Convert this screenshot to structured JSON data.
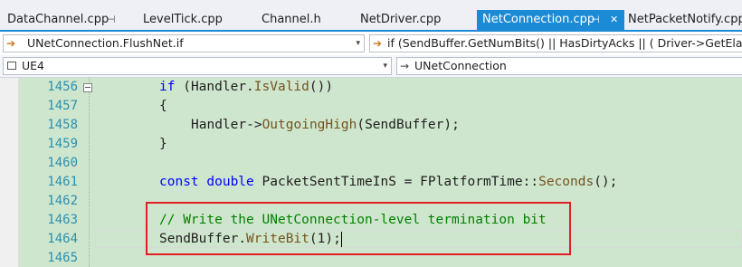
{
  "tabs": [
    {
      "label": "DataChannel.cpp",
      "pinned": true
    },
    {
      "label": "LevelTick.cpp"
    },
    {
      "label": "Channel.h"
    },
    {
      "label": "NetDriver.cpp"
    },
    {
      "label": "NetConnection.cpp",
      "active": true,
      "pinned": true,
      "closable": true
    },
    {
      "label": "NetPacketNotify.cpp"
    }
  ],
  "nav": {
    "scope": "UNetConnection.FlushNet.if",
    "condition": "if (SendBuffer.GetNumBits() || HasDirtyAcks || ( Driver->GetElapsedT",
    "project": "UE4",
    "class": "UNetConnection"
  },
  "glyphs": {
    "pin": "⊣",
    "close": "✕",
    "dropdown": "▾",
    "arrow": "➔"
  },
  "colors": {
    "accent": "#1c8bd6",
    "editor_bg": "#cfe6ce",
    "highlight_box": "#e02020"
  },
  "code": {
    "line_numbers": [
      "1456",
      "1457",
      "1458",
      "1459",
      "1460",
      "1461",
      "1462",
      "1463",
      "1464",
      "1465"
    ],
    "kw_if": "if",
    "handler": "Handler",
    "is_valid": "IsValid",
    "brace_open": "{",
    "brace_close": "}",
    "arrow_op": "->",
    "outgoing_high": "OutgoingHigh",
    "send_buffer": "SendBuffer",
    "kw_const": "const",
    "kw_double": "double",
    "var_name": "PacketSentTimeInS",
    "fplatform": "FPlatformTime",
    "seconds": "Seconds",
    "comment": "// Write the UNetConnection-level termination bit",
    "write_bit": "WriteBit"
  }
}
